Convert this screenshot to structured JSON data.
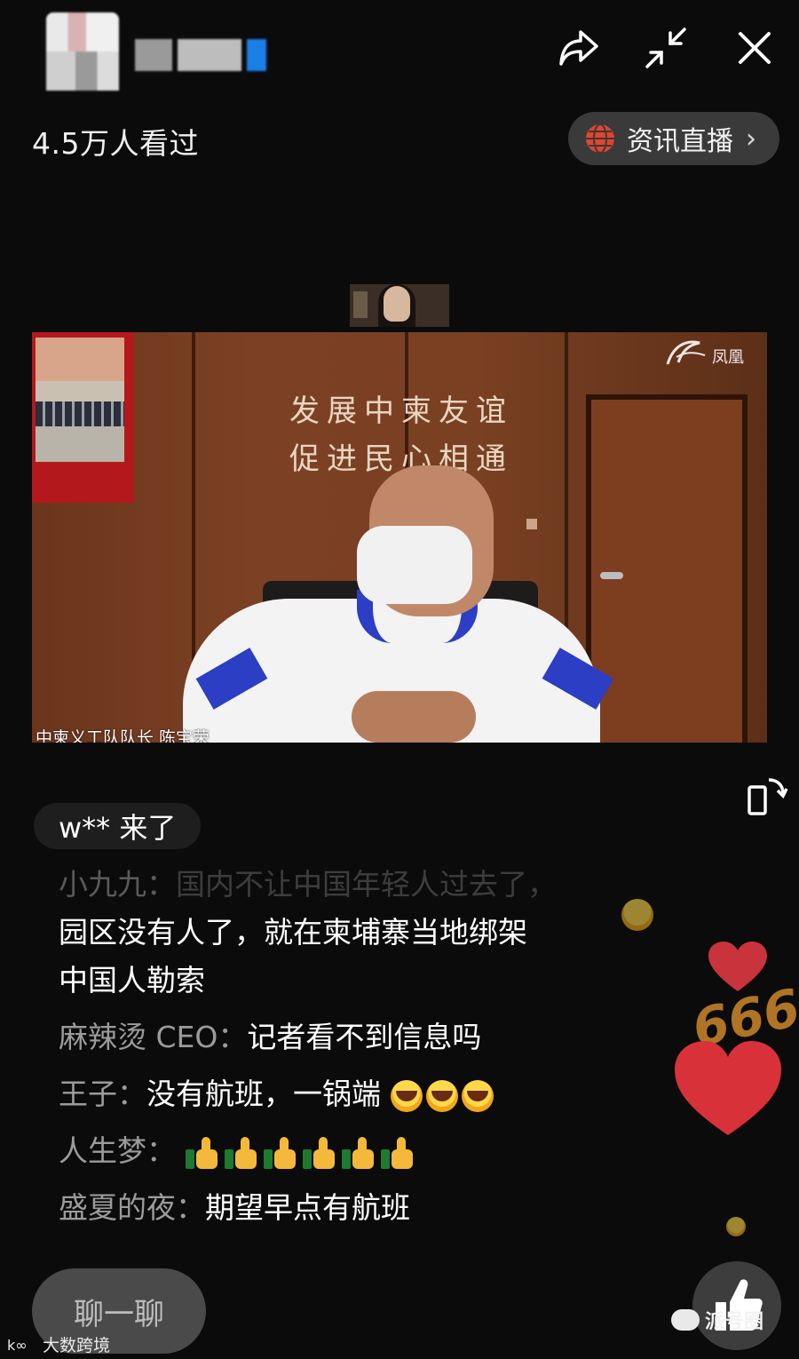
{
  "header": {
    "viewers": "4.5万人看过",
    "news_pill_label": "资讯直播",
    "news_pill_chevron": "›"
  },
  "video": {
    "wall_line1": "发展中柬友谊",
    "wall_line2": "促进民心相通",
    "caption": "中柬义工队队长 陈宝荣",
    "logo_text": "凤凰"
  },
  "chat": {
    "enter_text": "w** 来了",
    "messages": [
      {
        "nick": "小九九：",
        "text": "国内不让中国年轻人过去了，"
      },
      {
        "nick": "",
        "text": "园区没有人了，就在柬埔寨当地绑架"
      },
      {
        "nick": "",
        "text": "中国人勒索"
      },
      {
        "nick": "麻辣烫 CEO：",
        "text": "记者看不到信息吗"
      },
      {
        "nick": "王子：",
        "text": "没有航班，一锅端"
      },
      {
        "nick": "人生梦：",
        "text": ""
      },
      {
        "nick": "盛夏的夜：",
        "text": "期望早点有航班"
      }
    ]
  },
  "floating": {
    "text_666": "666"
  },
  "bottom": {
    "chat_button": "聊一聊",
    "watermark_left": "大数跨境",
    "watermark_right": "派号圈"
  },
  "colors": {
    "background": "#0b0b0b",
    "pill_bg": "#3a3a3a",
    "globe": "#e0452e",
    "heart": "#d8313a"
  }
}
